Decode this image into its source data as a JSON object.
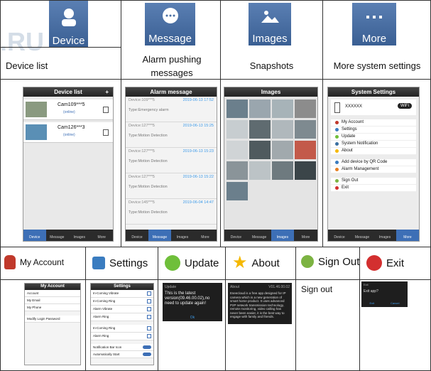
{
  "top_row": [
    {
      "label": "Device",
      "icon": "person-icon",
      "caption": "Device list"
    },
    {
      "label": "Message",
      "icon": "chat-bubble-icon",
      "caption": "Alarm pushing messages"
    },
    {
      "label": "Images",
      "icon": "image-icon",
      "caption": "Snapshots"
    },
    {
      "label": "More",
      "icon": "more-dots-icon",
      "caption": "More system settings"
    }
  ],
  "device_list": {
    "title": "Device list",
    "add": "+",
    "devices": [
      {
        "name": "Cam109***5",
        "status": "(online)"
      },
      {
        "name": "Cam126***3",
        "status": "(online)"
      }
    ]
  },
  "alarm": {
    "title": "Alarm message",
    "rows": [
      {
        "device": "Device:109***5",
        "time": "2019-06-13 17:52",
        "type": "Type:Emergency alarm"
      },
      {
        "device": "Device:127***5",
        "time": "2019-06-13 15:25",
        "type": "Type:Motion Detection"
      },
      {
        "device": "Device:127***5",
        "time": "2019-06-13 15:23",
        "type": "Type:Motion Detection"
      },
      {
        "device": "Device:127***5",
        "time": "2019-06-13 15:22",
        "type": "Type:Motion Detection"
      },
      {
        "device": "Device:145***5",
        "time": "2019-06-04 14:47",
        "type": "Type:Motion Detection"
      }
    ]
  },
  "images": {
    "title": "Images"
  },
  "system": {
    "title": "System Settings",
    "account_id": "XXXXXX",
    "badge": "WiFi",
    "items1": [
      "My Account",
      "Settings",
      "Update",
      "System Notification",
      "About"
    ],
    "items2": [
      "Add device by QR Code",
      "Alarm Management"
    ],
    "items3": [
      "Sign Out",
      "Exit"
    ]
  },
  "tabs": [
    "Device",
    "Message",
    "Images",
    "More"
  ],
  "bottom_headers": [
    {
      "label": "My Account",
      "icon": "account-icon"
    },
    {
      "label": "Settings",
      "icon": "settings-icon"
    },
    {
      "label": "Update",
      "icon": "update-icon"
    },
    {
      "label": "About",
      "icon": "star-icon"
    },
    {
      "label": "Sign Out",
      "icon": "sign-out-icon"
    },
    {
      "label": "Exit",
      "icon": "power-icon"
    }
  ],
  "my_account": {
    "title": "My Account",
    "rows": [
      "Account",
      "My Email",
      "My Phone",
      "Modify Login Password"
    ]
  },
  "settings": {
    "title": "Settings",
    "rows": [
      "In-Coming Vibrate",
      "In-Coming Ring",
      "Alarm Vibrate",
      "Alarm Ring",
      "In-Coming Ring",
      "Alarm Ring",
      "Notification Bar Icon",
      "Automatically Start"
    ]
  },
  "update": {
    "title": "Update",
    "text": "This is the latest version(09.46.00.02),no need to update again!"
  },
  "about": {
    "title": "About",
    "version": "V01.46.00.02",
    "text": "Eseecloud is a free app designed for IP camera which is a new generation of smart home product. It uses advanced P2P network transmission technology, remote monitoring, video calling has never been easier, it is the best way to engage with family and friends."
  },
  "signout": {
    "text": "Sign out"
  },
  "exit": {
    "title": "Exit",
    "question": "Exit app?",
    "ok": "Exit",
    "cancel": "Cancel"
  },
  "watermark": ".RU"
}
